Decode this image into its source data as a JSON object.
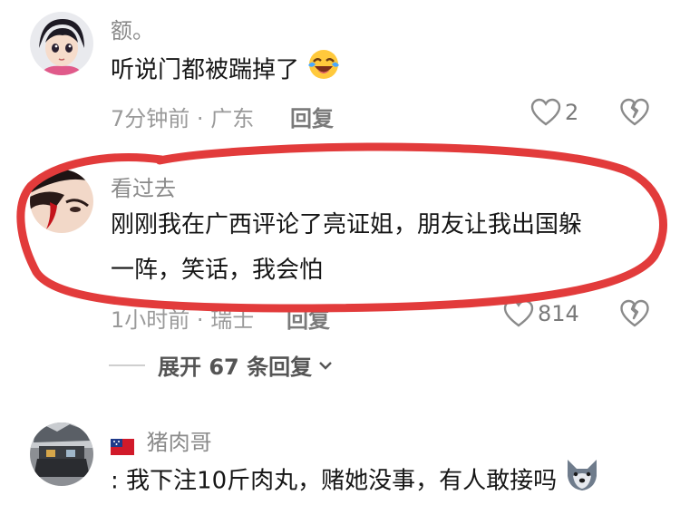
{
  "comments": [
    {
      "username": "额。",
      "text": "听说门都被踹掉了",
      "emoji": "laughing-crying-emoji",
      "time": "7分钟前",
      "separator": "·",
      "location": "广东",
      "reply_label": "回复",
      "likes": "2"
    },
    {
      "username": "看过去",
      "text_line1": "刚刚我在广西评论了亮证姐，朋友让我出国躲",
      "text_line2": "一阵，笑话，我会怕",
      "time": "1小时前",
      "separator": "·",
      "location": "瑞士",
      "reply_label": "回复",
      "likes": "814",
      "expand_label": "展开 67 条回复"
    },
    {
      "username": "猪肉哥",
      "flag": "samoa-flag",
      "text": ": 我下注10斤肉丸，赌她没事，有人敢接吗",
      "emoji": "wolf-emoji"
    }
  ],
  "colors": {
    "annotation_red": "#e23b3b",
    "meta_gray": "#9a9a9a",
    "text_dark": "#161616"
  }
}
